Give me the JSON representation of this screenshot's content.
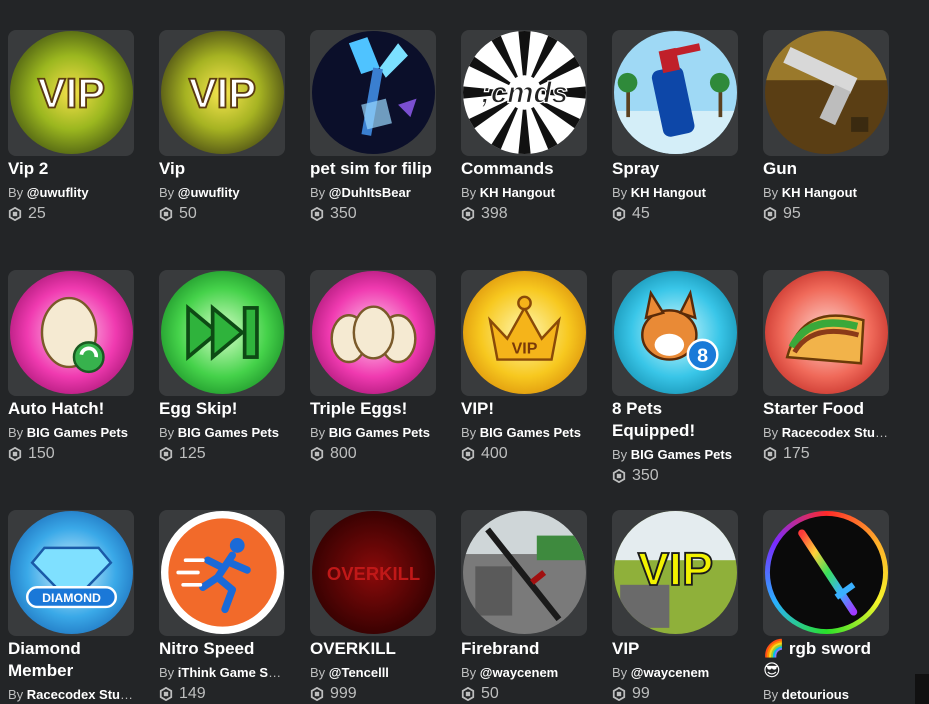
{
  "items": [
    {
      "name": "Vip 2",
      "by": "By",
      "creator": "@uwuflity",
      "price": "25",
      "icon": "vip-badge-icon"
    },
    {
      "name": "Vip",
      "by": "By",
      "creator": "@uwuflity",
      "price": "50",
      "icon": "vip-badge-icon"
    },
    {
      "name": "pet sim for filip",
      "by": "By",
      "creator": "@DuhItsBear",
      "price": "350",
      "icon": "crystal-pickaxe-icon"
    },
    {
      "name": "Commands",
      "by": "By",
      "creator": "KH Hangout",
      "price": "398",
      "icon": "cmds-logo-icon"
    },
    {
      "name": "Spray",
      "by": "By",
      "creator": "KH Hangout",
      "price": "45",
      "icon": "spray-bottle-icon"
    },
    {
      "name": "Gun",
      "by": "By",
      "creator": "KH Hangout",
      "price": "95",
      "icon": "pistol-icon"
    },
    {
      "name": "Auto Hatch!",
      "by": "By",
      "creator": "BIG Games Pets",
      "price": "150",
      "icon": "egg-recycle-icon"
    },
    {
      "name": "Egg Skip!",
      "by": "By",
      "creator": "BIG Games Pets",
      "price": "125",
      "icon": "fast-forward-icon"
    },
    {
      "name": "Triple Eggs!",
      "by": "By",
      "creator": "BIG Games Pets",
      "price": "800",
      "icon": "triple-eggs-icon"
    },
    {
      "name": "VIP!",
      "by": "By",
      "creator": "BIG Games Pets",
      "price": "400",
      "icon": "vip-crown-icon"
    },
    {
      "name": "8 Pets Equipped!",
      "by": "By",
      "creator": "BIG Games Pets",
      "price": "350",
      "icon": "dog-pet-icon"
    },
    {
      "name": "Starter Food",
      "by": "By",
      "creator": "Racecodex Studios",
      "price": "175",
      "icon": "taco-icon"
    },
    {
      "name": "Diamond Member",
      "by": "By",
      "creator": "Racecodex Studios",
      "price": "",
      "icon": "diamond-icon"
    },
    {
      "name": "Nitro Speed",
      "by": "By",
      "creator": "iThink Game Studios",
      "price": "149",
      "icon": "running-man-icon"
    },
    {
      "name": "OVERKILL",
      "by": "By",
      "creator": "@Tencelll",
      "price": "999",
      "icon": "overkill-text-icon"
    },
    {
      "name": "Firebrand",
      "by": "By",
      "creator": "@waycenem",
      "price": "50",
      "icon": "sword-icon"
    },
    {
      "name": "VIP",
      "by": "By",
      "creator": "@waycenem",
      "price": "99",
      "icon": "vip-text-icon"
    },
    {
      "name": "🌈 rgb sword 😎",
      "by": "By",
      "creator": "detourious",
      "price": "",
      "icon": "rainbow-sword-icon"
    }
  ],
  "colors": {
    "background": "#232527",
    "card": "#393b3d",
    "muted": "#bdbebe"
  }
}
